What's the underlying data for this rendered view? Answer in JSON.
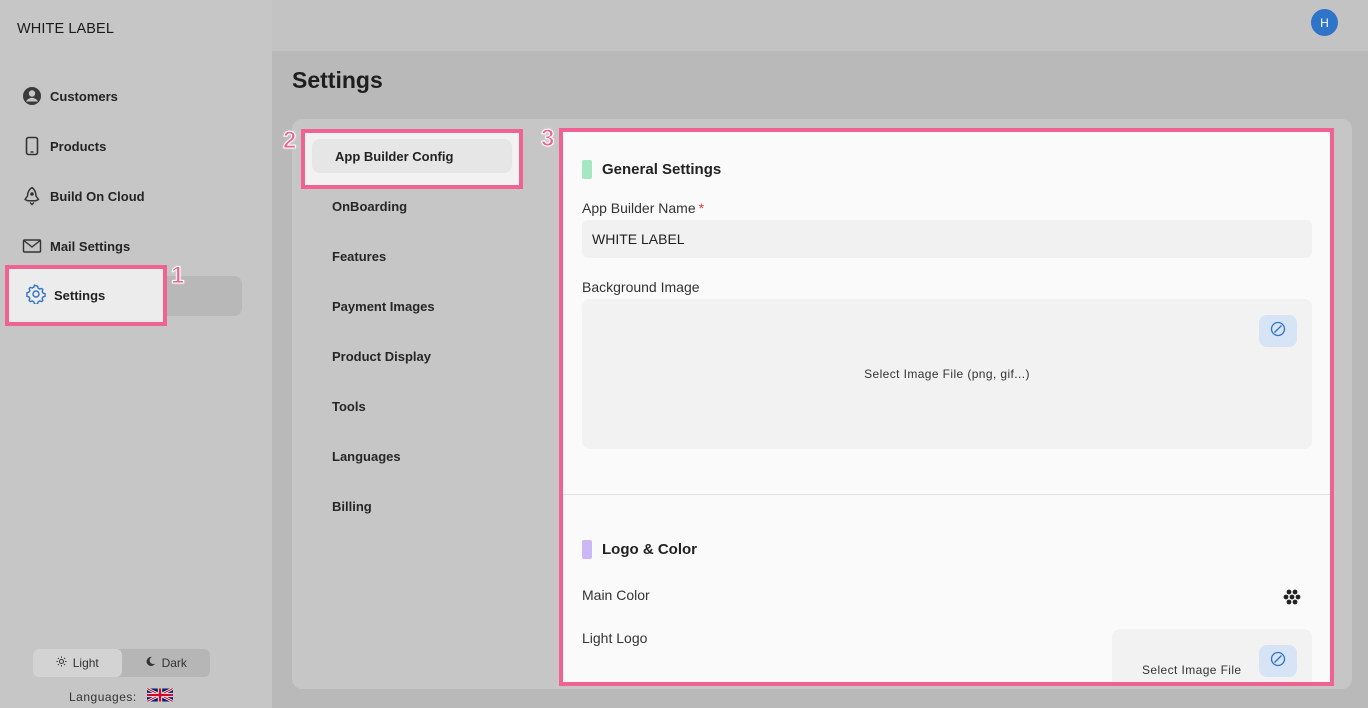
{
  "app": {
    "brand": "WHITE LABEL",
    "avatar_initial": "H"
  },
  "sidebar": {
    "items": [
      {
        "label": "Customers",
        "icon": "user-circle-icon"
      },
      {
        "label": "Products",
        "icon": "phone-icon"
      },
      {
        "label": "Build On Cloud",
        "icon": "rocket-icon"
      },
      {
        "label": "Mail Settings",
        "icon": "mail-icon"
      },
      {
        "label": "Settings",
        "icon": "gear-icon",
        "active": true
      }
    ],
    "theme": {
      "light_label": "Light",
      "dark_label": "Dark",
      "selected": "Light"
    },
    "languages_label": "Languages:"
  },
  "callouts": [
    "1",
    "2",
    "3"
  ],
  "page": {
    "title": "Settings"
  },
  "settings_nav": {
    "items": [
      {
        "label": "App Builder Config",
        "active": true
      },
      {
        "label": "OnBoarding"
      },
      {
        "label": "Features"
      },
      {
        "label": "Payment Images"
      },
      {
        "label": "Product Display"
      },
      {
        "label": "Tools"
      },
      {
        "label": "Languages"
      },
      {
        "label": "Billing"
      }
    ]
  },
  "panel": {
    "general": {
      "title": "General Settings",
      "app_builder_name_label": "App Builder Name",
      "required_mark": "*",
      "app_builder_name_value": "WHITE LABEL",
      "background_image_label": "Background Image",
      "background_image_placeholder": "Select Image File (png, gif...)"
    },
    "logo_color": {
      "title": "Logo & Color",
      "main_color_label": "Main Color",
      "light_logo_label": "Light Logo",
      "light_logo_placeholder": "Select Image File"
    }
  },
  "colors": {
    "accent_highlight": "#f06292",
    "avatar": "#2f74c8",
    "general_marker": "#a5e6c3",
    "logo_marker": "#cbb8f5",
    "clear_button_bg": "#d6e4f6"
  }
}
